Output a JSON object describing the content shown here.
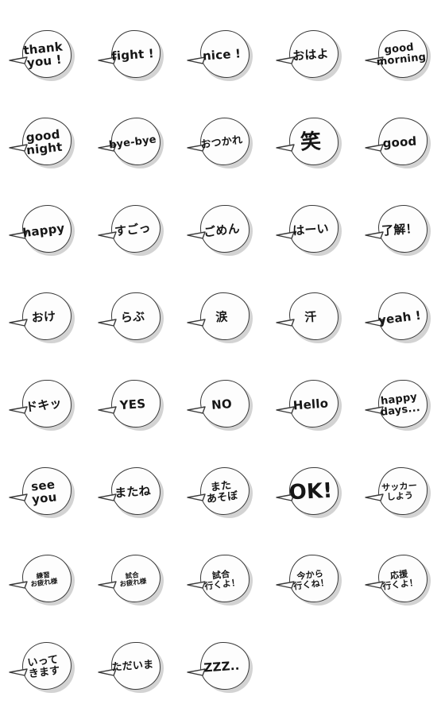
{
  "page": {
    "title": "Speech Bubble Emoji Sticker Sheet",
    "background_color": "#ffffff",
    "bubble_fill": "#fdfdfd",
    "bubble_outline": "#3a3a3a",
    "shadow_color": "#d3d3d3",
    "text_color": "#161616",
    "columns": 5,
    "rows": 8,
    "total_stickers": 38
  },
  "stickers": [
    {
      "id": 1,
      "text": "thank\nyou !",
      "size": "s-lg",
      "rot": "rot-a",
      "shape": "v1"
    },
    {
      "id": 2,
      "text": "fight !",
      "size": "s-lg",
      "rot": "rot-b",
      "shape": "v2"
    },
    {
      "id": 3,
      "text": "nice !",
      "size": "s-lg",
      "rot": "rot-b",
      "shape": "v3"
    },
    {
      "id": 4,
      "text": "おはよ",
      "size": "s-lg",
      "rot": "rot-b",
      "shape": "v4"
    },
    {
      "id": 5,
      "text": "good\nmorning",
      "size": "s-md",
      "rot": "rot-a",
      "shape": "v1"
    },
    {
      "id": 6,
      "text": "good\nnight",
      "size": "s-lg",
      "rot": "rot-a",
      "shape": "v2"
    },
    {
      "id": 7,
      "text": "bye-bye",
      "size": "s-md",
      "rot": "rot-c",
      "shape": "v3"
    },
    {
      "id": 8,
      "text": "おつかれ",
      "size": "s-md",
      "rot": "rot-c",
      "shape": "v4"
    },
    {
      "id": 9,
      "text": "笑",
      "size": "s-xl",
      "rot": "rot-d",
      "shape": "v1"
    },
    {
      "id": 10,
      "text": "good",
      "size": "s-lg",
      "rot": "rot-b",
      "shape": "v2"
    },
    {
      "id": 11,
      "text": "happy",
      "size": "s-lg",
      "rot": "rot-c",
      "shape": "v3"
    },
    {
      "id": 12,
      "text": "すごっ",
      "size": "s-lg",
      "rot": "rot-a",
      "shape": "v4"
    },
    {
      "id": 13,
      "text": "ごめん",
      "size": "s-lg",
      "rot": "rot-c",
      "shape": "v1"
    },
    {
      "id": 14,
      "text": "はーい",
      "size": "s-lg",
      "rot": "rot-b",
      "shape": "v2"
    },
    {
      "id": 15,
      "text": "了解！",
      "size": "s-lg",
      "rot": "rot-b",
      "shape": "v3"
    },
    {
      "id": 16,
      "text": "おけ",
      "size": "s-lg",
      "rot": "rot-b",
      "shape": "v4"
    },
    {
      "id": 17,
      "text": "らぶ",
      "size": "s-lg",
      "rot": "rot-b",
      "shape": "v1"
    },
    {
      "id": 18,
      "text": "涙",
      "size": "s-lg",
      "rot": "rot-b",
      "shape": "v2"
    },
    {
      "id": 19,
      "text": "汗",
      "size": "s-lg",
      "rot": "rot-b",
      "shape": "v3"
    },
    {
      "id": 20,
      "text": "yeah !",
      "size": "s-lg",
      "rot": "rot-c",
      "shape": "v4"
    },
    {
      "id": 21,
      "text": "ドキッ",
      "size": "s-lg",
      "rot": "rot-c",
      "shape": "v1"
    },
    {
      "id": 22,
      "text": "YES",
      "size": "s-lg",
      "rot": "rot-b",
      "shape": "v2"
    },
    {
      "id": 23,
      "text": "NO",
      "size": "s-lg",
      "rot": "rot-b",
      "shape": "v3"
    },
    {
      "id": 24,
      "text": "Hello",
      "size": "s-lg",
      "rot": "rot-b",
      "shape": "v4"
    },
    {
      "id": 25,
      "text": "happy\ndays...",
      "size": "s-md",
      "rot": "rot-c",
      "shape": "v1"
    },
    {
      "id": 26,
      "text": "see\nyou",
      "size": "s-lg",
      "rot": "rot-a",
      "shape": "v2"
    },
    {
      "id": 27,
      "text": "またね",
      "size": "s-lg",
      "rot": "rot-b",
      "shape": "v3"
    },
    {
      "id": 28,
      "text": "また\nあそぼ",
      "size": "s-md",
      "rot": "rot-c",
      "shape": "v4"
    },
    {
      "id": 29,
      "text": "OK!",
      "size": "s-xl",
      "rot": "rot-d",
      "shape": "v1"
    },
    {
      "id": 30,
      "text": "サッカー\nしよう",
      "size": "s-sm",
      "rot": "rot-b",
      "shape": "v2"
    },
    {
      "id": 31,
      "text": "練習\nお疲れ様",
      "size": "s-xs",
      "rot": "rot-c",
      "shape": "v3"
    },
    {
      "id": 32,
      "text": "試合\nお疲れ様",
      "size": "s-xs",
      "rot": "rot-c",
      "shape": "v4"
    },
    {
      "id": 33,
      "text": "試合\n行くよ！",
      "size": "s-sm",
      "rot": "rot-c",
      "shape": "v1"
    },
    {
      "id": 34,
      "text": "今から\n行くね！",
      "size": "s-sm",
      "rot": "rot-c",
      "shape": "v2"
    },
    {
      "id": 35,
      "text": "応援\n行くよ！",
      "size": "s-sm",
      "rot": "rot-c",
      "shape": "v3"
    },
    {
      "id": 36,
      "text": "いって\nきます",
      "size": "s-md",
      "rot": "rot-c",
      "shape": "v4"
    },
    {
      "id": 37,
      "text": "ただいま",
      "size": "s-md",
      "rot": "rot-b",
      "shape": "v1"
    },
    {
      "id": 38,
      "text": "ZZZ..",
      "size": "s-lg",
      "rot": "rot-b",
      "shape": "v2"
    }
  ]
}
